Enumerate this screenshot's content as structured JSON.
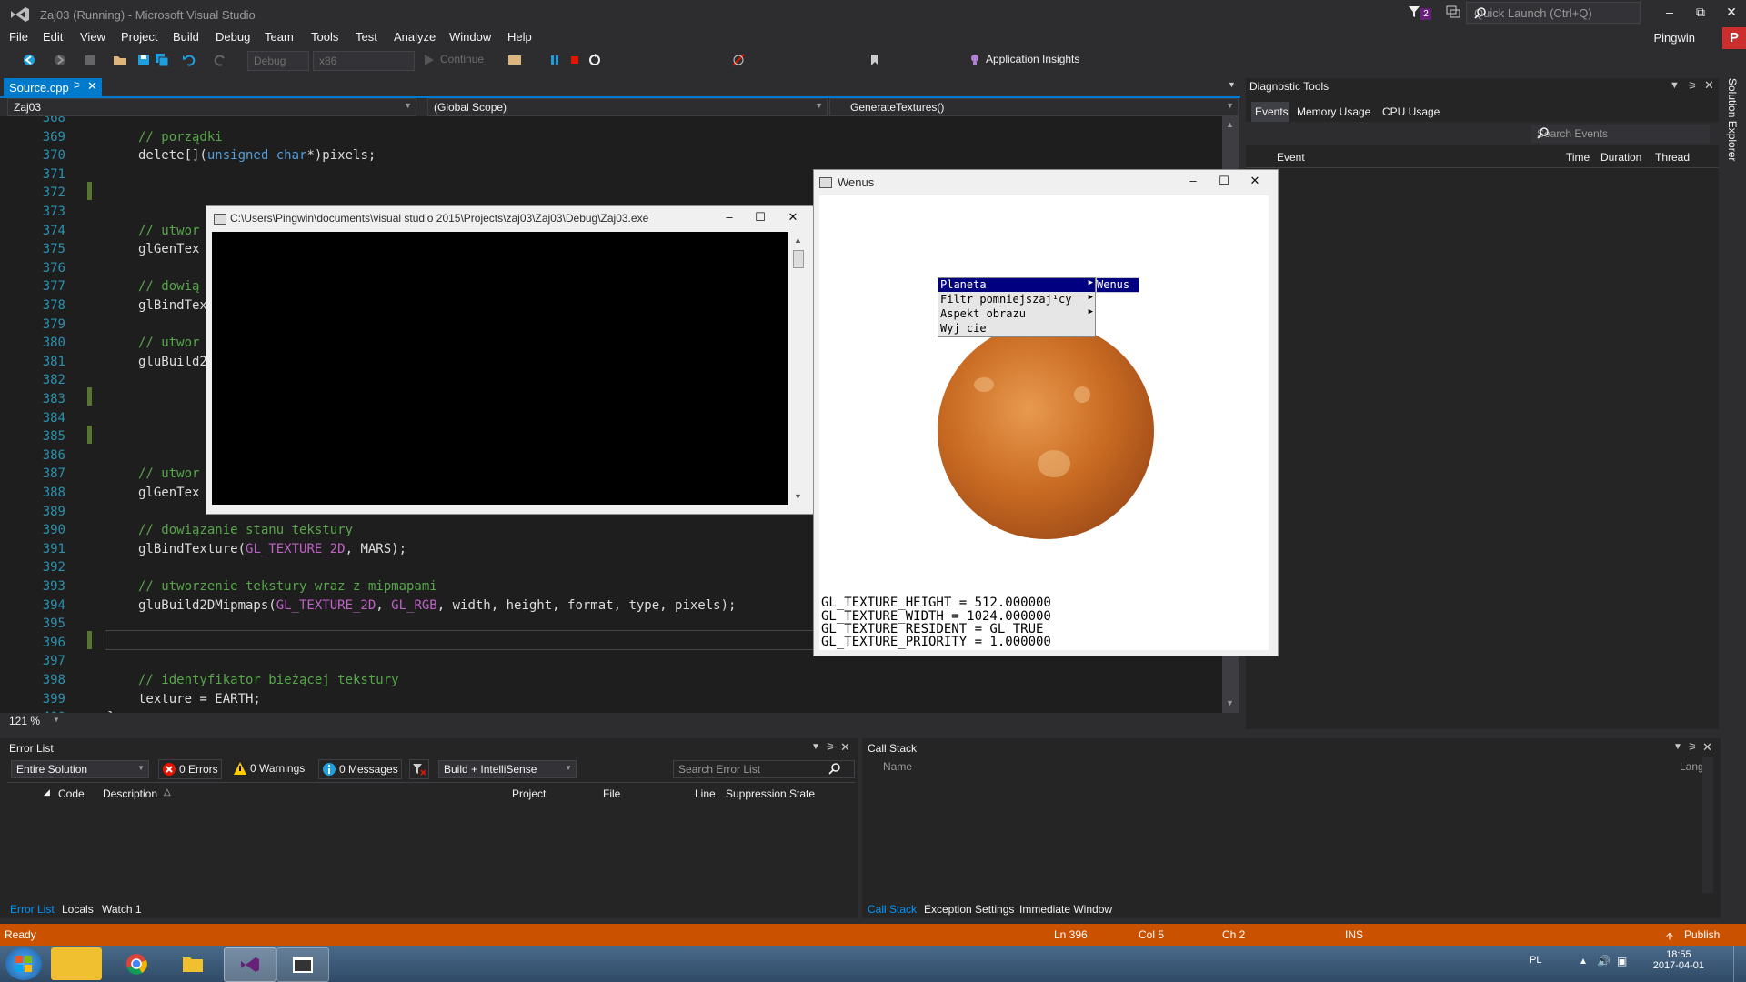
{
  "window": {
    "title": "Zaj03 (Running) - Microsoft Visual Studio",
    "notification_count": "2"
  },
  "quick_launch": {
    "placeholder": "Quick Launch (Ctrl+Q)"
  },
  "menu": [
    "File",
    "Edit",
    "View",
    "Project",
    "Build",
    "Debug",
    "Team",
    "Tools",
    "Test",
    "Analyze",
    "Window",
    "Help"
  ],
  "user": {
    "name": "Pingwin",
    "badge": "P"
  },
  "toolbar": {
    "config": "Debug",
    "platform": "x86",
    "continue": "Continue",
    "app_insights": "Application Insights"
  },
  "doc_tab": {
    "label": "Source.cpp"
  },
  "nav": {
    "project": "Zaj03",
    "scope": "(Global Scope)",
    "member": "GenerateTextures()"
  },
  "editor": {
    "zoom": "121 %",
    "lines": [
      {
        "n": "368",
        "parts": []
      },
      {
        "n": "369",
        "parts": [
          [
            "cm",
            "// porządki"
          ]
        ]
      },
      {
        "n": "370",
        "parts": [
          [
            "",
            "delete[]("
          ],
          [
            "kw",
            "unsigned char"
          ],
          [
            "",
            "*)pixels;"
          ]
        ]
      },
      {
        "n": "371",
        "parts": []
      },
      {
        "n": "372",
        "parts": []
      },
      {
        "n": "373",
        "parts": []
      },
      {
        "n": "374",
        "parts": [
          [
            "cm",
            "// utwor"
          ]
        ]
      },
      {
        "n": "375",
        "parts": [
          [
            "",
            "glGenTex"
          ]
        ]
      },
      {
        "n": "376",
        "parts": []
      },
      {
        "n": "377",
        "parts": [
          [
            "cm",
            "// dowią"
          ]
        ]
      },
      {
        "n": "378",
        "parts": [
          [
            "",
            "glBindTex"
          ]
        ]
      },
      {
        "n": "379",
        "parts": []
      },
      {
        "n": "380",
        "parts": [
          [
            "cm",
            "// utwor"
          ]
        ]
      },
      {
        "n": "381",
        "parts": [
          [
            "",
            "gluBuild2"
          ]
        ]
      },
      {
        "n": "382",
        "parts": []
      },
      {
        "n": "383",
        "parts": []
      },
      {
        "n": "384",
        "parts": []
      },
      {
        "n": "385",
        "parts": []
      },
      {
        "n": "386",
        "parts": []
      },
      {
        "n": "387",
        "parts": [
          [
            "cm",
            "// utwor"
          ]
        ]
      },
      {
        "n": "388",
        "parts": [
          [
            "",
            "glGenTex"
          ]
        ]
      },
      {
        "n": "389",
        "parts": []
      },
      {
        "n": "390",
        "parts": [
          [
            "cm",
            "// dowiązanie stanu tekstury"
          ]
        ]
      },
      {
        "n": "391",
        "parts": [
          [
            "",
            "glBindTexture("
          ],
          [
            "mac",
            "GL_TEXTURE_2D"
          ],
          [
            "",
            ", MARS);"
          ]
        ]
      },
      {
        "n": "392",
        "parts": []
      },
      {
        "n": "393",
        "parts": [
          [
            "cm",
            "// utworzenie tekstury wraz z mipmapami"
          ]
        ]
      },
      {
        "n": "394",
        "parts": [
          [
            "",
            "gluBuild2DMipmaps("
          ],
          [
            "mac",
            "GL_TEXTURE_2D"
          ],
          [
            "",
            ", "
          ],
          [
            "mac",
            "GL_RGB"
          ],
          [
            "",
            ", width, height, format, type, pixels);"
          ]
        ]
      },
      {
        "n": "395",
        "parts": []
      },
      {
        "n": "396",
        "parts": []
      },
      {
        "n": "397",
        "parts": []
      },
      {
        "n": "398",
        "parts": [
          [
            "cm",
            "// identyfikator bieżącej tekstury"
          ]
        ]
      },
      {
        "n": "399",
        "parts": [
          [
            "",
            "texture = EARTH;"
          ]
        ]
      },
      {
        "n": "400",
        "parts": [
          [
            "",
            "}"
          ]
        ]
      }
    ]
  },
  "diagnostic": {
    "title": "Diagnostic Tools",
    "tabs": [
      "Events",
      "Memory Usage",
      "CPU Usage"
    ],
    "search_placeholder": "Search Events",
    "columns": [
      "Event",
      "Time",
      "Duration",
      "Thread"
    ]
  },
  "solution_explorer": {
    "label": "Solution Explorer"
  },
  "console": {
    "title": "C:\\Users\\Pingwin\\documents\\visual studio 2015\\Projects\\zaj03\\Zaj03\\Debug\\Zaj03.exe"
  },
  "wenus": {
    "title": "Wenus",
    "menu": [
      "Planeta",
      "Filtr pomniejszaj¹cy",
      "Aspekt obrazu",
      "Wyj cie"
    ],
    "submenu": "Wenus",
    "info": [
      "GL_TEXTURE_HEIGHT = 512.000000",
      "GL_TEXTURE_WIDTH = 1024.000000",
      "GL_TEXTURE_RESIDENT = GL_TRUE",
      "GL_TEXTURE_PRIORITY = 1.000000"
    ]
  },
  "error_list": {
    "title": "Error List",
    "scope": "Entire Solution",
    "errors": "0 Errors",
    "warnings": "0 Warnings",
    "messages": "0 Messages",
    "build_filter": "Build + IntelliSense",
    "search_placeholder": "Search Error List",
    "columns": [
      "Code",
      "Description",
      "Project",
      "File",
      "Line",
      "Suppression State"
    ]
  },
  "call_stack": {
    "title": "Call Stack",
    "columns": [
      "Name",
      "Lang"
    ]
  },
  "bottom_tabs_left": [
    "Error List",
    "Locals",
    "Watch 1"
  ],
  "bottom_tabs_right": [
    "Call Stack",
    "Exception Settings",
    "Immediate Window"
  ],
  "status": {
    "state": "Ready",
    "ln": "Ln 396",
    "col": "Col 5",
    "ch": "Ch 2",
    "mode": "INS",
    "publish": "Publish"
  },
  "taskbar": {
    "lang": "PL",
    "time": "18:55",
    "date": "2017-04-01"
  },
  "colors": {
    "accent": "#007acc",
    "status_debug": "#ca5100"
  }
}
